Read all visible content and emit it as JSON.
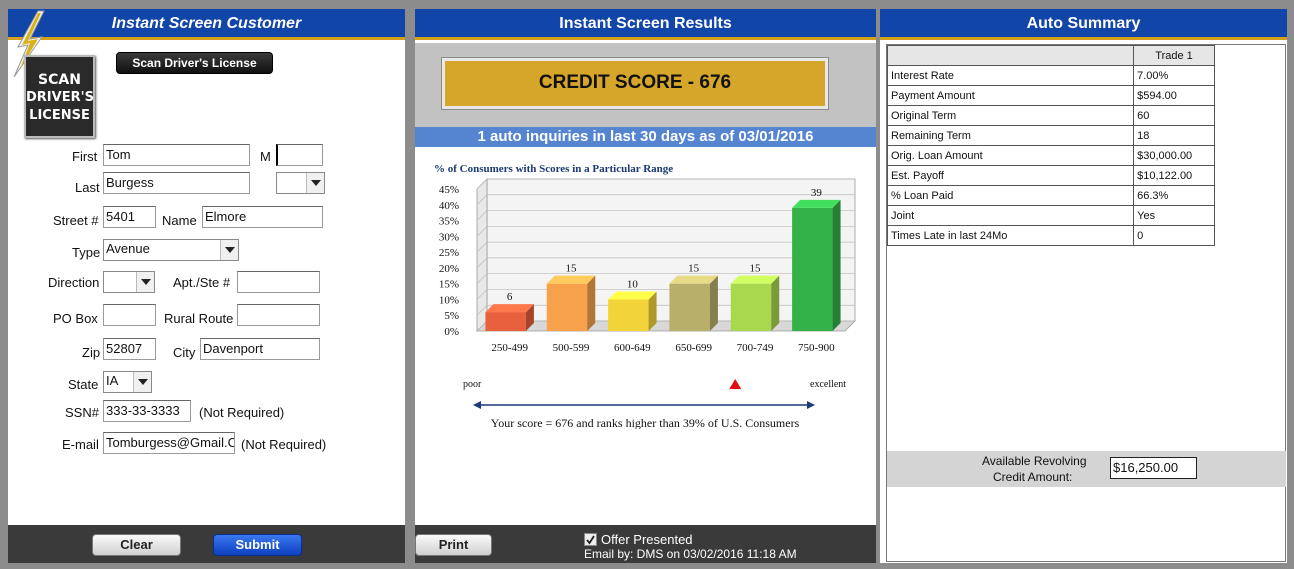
{
  "customer": {
    "title": "Instant Screen Customer",
    "scan_button": "Scan Driver's License",
    "scan_logo_text": [
      "SCAN",
      "DRIVER'S",
      "LICENSE"
    ],
    "labels": {
      "first": "First",
      "middle": "M",
      "last": "Last",
      "street_num": "Street #",
      "name": "Name",
      "type": "Type",
      "direction": "Direction",
      "apt": "Apt./Ste #",
      "po_box": "PO Box",
      "rural_route": "Rural Route",
      "zip": "Zip",
      "city": "City",
      "state": "State",
      "ssn": "SSN#",
      "email": "E-mail",
      "not_required": "(Not Required)"
    },
    "values": {
      "first": "Tom",
      "middle": "",
      "last": "Burgess",
      "suffix": "",
      "street_num": "5401",
      "street_name": "Elmore",
      "type": "Avenue",
      "direction": "",
      "apt": "",
      "po_box": "",
      "rural_route": "",
      "zip": "52807",
      "city": "Davenport",
      "state": "IA",
      "ssn": "333-33-3333",
      "email": "Tomburgess@Gmail.C"
    },
    "clear_button": "Clear",
    "submit_button": "Submit"
  },
  "results": {
    "title": "Instant Screen Results",
    "credit_score": "CREDIT SCORE - 676",
    "inquiries": "1 auto inquiries in last 30 days as of 03/01/2016",
    "print_button": "Print",
    "offer_presented": "Offer Presented",
    "offer_checked": true,
    "email_by": "Email by: DMS  on 03/02/2016 11:18 AM",
    "scale_poor": "poor",
    "scale_excellent": "excellent",
    "score_position": 0.39,
    "rank_text": "Your score = 676 and ranks higher than 39% of U.S. Consumers"
  },
  "chart_data": {
    "type": "bar",
    "title": "% of Consumers with Scores in a Particular Range",
    "categories": [
      "250-499",
      "500-599",
      "600-649",
      "650-699",
      "700-749",
      "750-900"
    ],
    "values": [
      6,
      15,
      10,
      15,
      15,
      39
    ],
    "ylim": [
      0,
      45
    ],
    "yticks": [
      "0%",
      "5%",
      "10%",
      "15%",
      "20%",
      "25%",
      "30%",
      "35%",
      "40%",
      "45%"
    ],
    "colors": [
      "#e8603c",
      "#f7a24a",
      "#f2d43a",
      "#b8b06a",
      "#a8d84e",
      "#34b24a"
    ],
    "grid": true,
    "xlabel": "",
    "ylabel": ""
  },
  "summary": {
    "title": "Auto Summary",
    "column_header": "Trade 1",
    "rows": [
      {
        "label": "Interest Rate",
        "value": "7.00%"
      },
      {
        "label": "Payment Amount",
        "value": "$594.00"
      },
      {
        "label": "Original Term",
        "value": "60"
      },
      {
        "label": "Remaining Term",
        "value": "18"
      },
      {
        "label": "Orig. Loan Amount",
        "value": "$30,000.00"
      },
      {
        "label": "Est. Payoff",
        "value": "$10,122.00"
      },
      {
        "label": "% Loan Paid",
        "value": "66.3%"
      },
      {
        "label": "Joint",
        "value": "Yes"
      },
      {
        "label": "Times Late in last 24Mo",
        "value": "0"
      }
    ],
    "revolving_label_1": "Available Revolving",
    "revolving_label_2": "Credit Amount:",
    "revolving_value": "$16,250.00"
  }
}
